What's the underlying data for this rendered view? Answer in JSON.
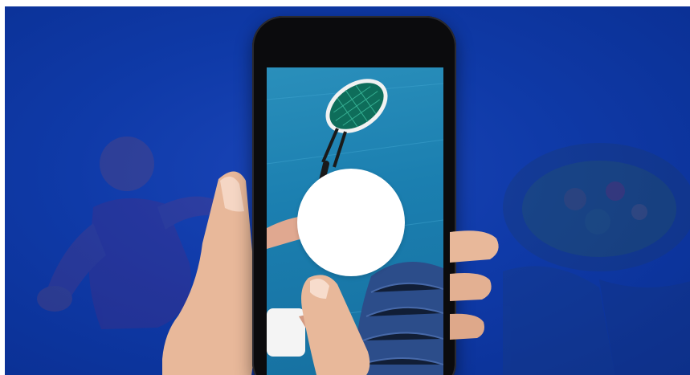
{
  "banner": {
    "background_color": "#0f3aa8",
    "accent_color": "#1a45b8"
  },
  "phone": {
    "frame_color": "#0b0b0d",
    "screen_scene": "tennis-racket-icon",
    "overlay_button_color": "#ffffff"
  },
  "icons": {
    "racket": "tennis-racket-icon",
    "towel": "towel-icon",
    "player": "player-silhouette-icon",
    "salad": "salad-bowl-icon",
    "overlay": "play-circle-icon"
  }
}
